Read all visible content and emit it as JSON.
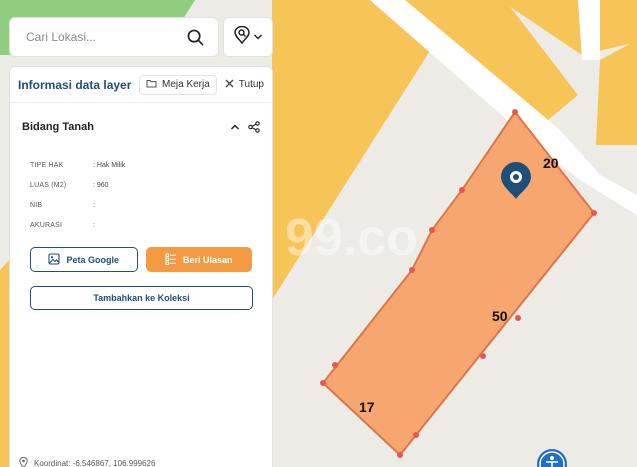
{
  "search": {
    "placeholder": "Cari Lokasi..."
  },
  "panel": {
    "title": "Informasi data layer",
    "workspace_label": "Meja Kerja",
    "close_label": "Tutup"
  },
  "section": {
    "title": "Bidang Tanah"
  },
  "attributes": [
    {
      "key": "TIPE HAK",
      "value": ": Hak Milik"
    },
    {
      "key": "LUAS (M2)",
      "value": ": 960"
    },
    {
      "key": "NIB",
      "value": ":"
    },
    {
      "key": "AKURASI",
      "value": ":"
    }
  ],
  "actions": {
    "google_label": "Peta Google",
    "review_label": "Beri Ulasan",
    "collection_label": "Tambahkan ke Koleksi"
  },
  "coordinate": {
    "label": "Koordinat: -6.546867, 106.999626"
  },
  "map": {
    "dimensions": {
      "top": "20",
      "right": "50",
      "bottom": "17"
    },
    "watermark": "99.co",
    "colors": {
      "background": "#ecebe6",
      "parcel_fill": "#f6a66e",
      "parcel_stroke": "#d8784a",
      "vertex": "#e8584a",
      "yellow_zone": "#f7c557",
      "green_zone": "#8fce7e",
      "road": "#ffffff",
      "pin": "#1f4e79",
      "accent": "#f39a42"
    }
  },
  "icons": [
    "search-icon",
    "location-search-icon",
    "chevron-down-icon",
    "folder-icon",
    "close-icon",
    "chevron-up-icon",
    "share-icon",
    "image-icon",
    "review-list-icon",
    "location-pin-icon",
    "map-pin-icon",
    "accessibility-icon"
  ]
}
